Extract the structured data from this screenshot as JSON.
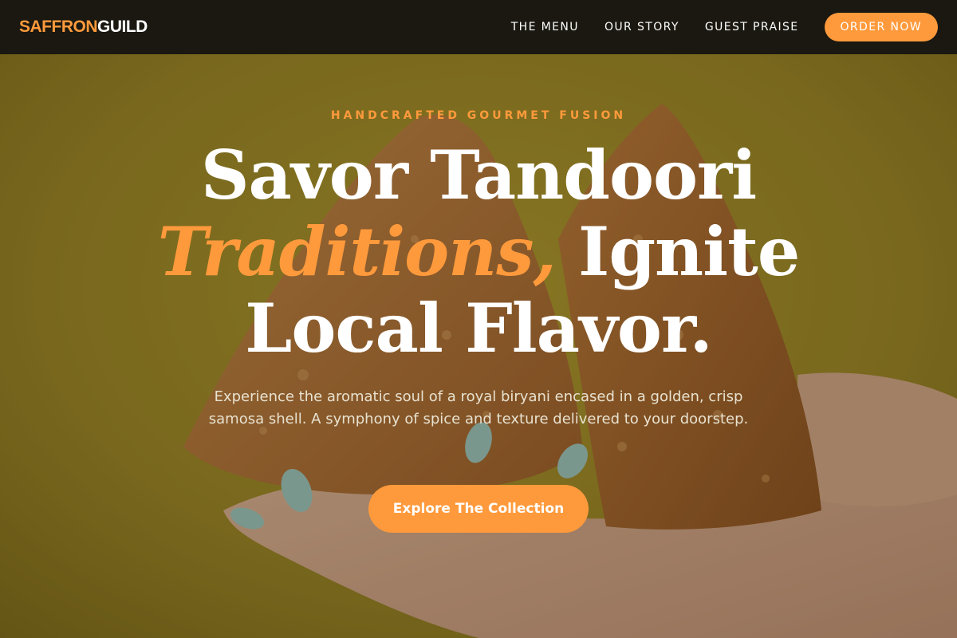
{
  "brand": {
    "logo_part1": "SAFFRON",
    "logo_part2": "GUILD",
    "accent_color": "#ff9a3c",
    "nav_bg": "#1a1810"
  },
  "nav": {
    "links": [
      "THE MENU",
      "OUR STORY",
      "GUEST PRAISE"
    ],
    "cta_label": "ORDER NOW"
  },
  "hero": {
    "eyebrow": "HANDCRAFTED GOURMET FUSION",
    "headline_line1": "Savor Tandoori",
    "headline_accent": "Traditions,",
    "headline_line2_rest": " Ignite",
    "headline_line3": "Local Flavor.",
    "subtext": "Experience the aromatic soul of a royal biryani encased in a golden, crisp samosa shell. A symphony of spice and texture delivered to your doorstep.",
    "cta_label": "Explore The Collection",
    "background_image": "hand-holding-samosa"
  }
}
